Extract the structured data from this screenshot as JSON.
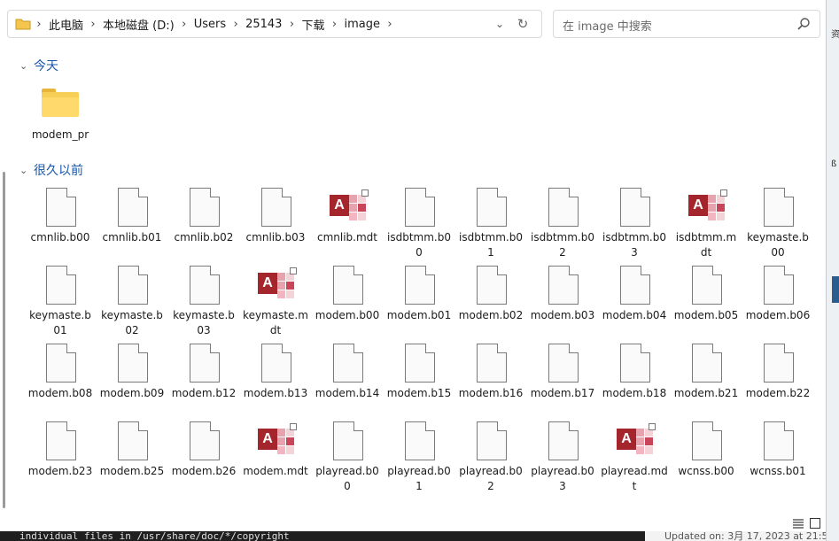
{
  "breadcrumb": [
    "此电脑",
    "本地磁盘 (D:)",
    "Users",
    "25143",
    "下载",
    "image"
  ],
  "search": {
    "placeholder": "在 image 中搜索"
  },
  "groups": {
    "today": {
      "label": "今天",
      "items": [
        {
          "name": "modem_pr",
          "type": "folder"
        }
      ]
    },
    "longago": {
      "label": "很久以前",
      "items": [
        {
          "name": "cmnlib.b00",
          "type": "file"
        },
        {
          "name": "cmnlib.b01",
          "type": "file"
        },
        {
          "name": "cmnlib.b02",
          "type": "file"
        },
        {
          "name": "cmnlib.b03",
          "type": "file"
        },
        {
          "name": "cmnlib.mdt",
          "type": "access"
        },
        {
          "name": "isdbtmm.b00",
          "type": "file"
        },
        {
          "name": "isdbtmm.b01",
          "type": "file"
        },
        {
          "name": "isdbtmm.b02",
          "type": "file"
        },
        {
          "name": "isdbtmm.b03",
          "type": "file"
        },
        {
          "name": "isdbtmm.mdt",
          "type": "access"
        },
        {
          "name": "keymaste.b00",
          "type": "file"
        },
        {
          "name": "keymaste.b01",
          "type": "file"
        },
        {
          "name": "keymaste.b02",
          "type": "file"
        },
        {
          "name": "keymaste.b03",
          "type": "file"
        },
        {
          "name": "keymaste.mdt",
          "type": "access"
        },
        {
          "name": "modem.b00",
          "type": "file"
        },
        {
          "name": "modem.b01",
          "type": "file"
        },
        {
          "name": "modem.b02",
          "type": "file"
        },
        {
          "name": "modem.b03",
          "type": "file"
        },
        {
          "name": "modem.b04",
          "type": "file"
        },
        {
          "name": "modem.b05",
          "type": "file"
        },
        {
          "name": "modem.b06",
          "type": "file"
        },
        {
          "name": "modem.b08",
          "type": "file"
        },
        {
          "name": "modem.b09",
          "type": "file"
        },
        {
          "name": "modem.b12",
          "type": "file"
        },
        {
          "name": "modem.b13",
          "type": "file"
        },
        {
          "name": "modem.b14",
          "type": "file"
        },
        {
          "name": "modem.b15",
          "type": "file"
        },
        {
          "name": "modem.b16",
          "type": "file"
        },
        {
          "name": "modem.b17",
          "type": "file"
        },
        {
          "name": "modem.b18",
          "type": "file"
        },
        {
          "name": "modem.b21",
          "type": "file"
        },
        {
          "name": "modem.b22",
          "type": "file"
        },
        {
          "name": "modem.b23",
          "type": "file"
        },
        {
          "name": "modem.b25",
          "type": "file"
        },
        {
          "name": "modem.b26",
          "type": "file"
        },
        {
          "name": "modem.mdt",
          "type": "access"
        },
        {
          "name": "playread.b00",
          "type": "file"
        },
        {
          "name": "playread.b01",
          "type": "file"
        },
        {
          "name": "playread.b02",
          "type": "file"
        },
        {
          "name": "playread.b03",
          "type": "file"
        },
        {
          "name": "playread.mdt",
          "type": "access"
        },
        {
          "name": "wcnss.b00",
          "type": "file"
        },
        {
          "name": "wcnss.b01",
          "type": "file"
        }
      ]
    }
  },
  "terminal_text": "individual files in /usr/share/doc/*/copyright",
  "updated_text": "Updated on: 3月 17, 2023 at 21:5"
}
